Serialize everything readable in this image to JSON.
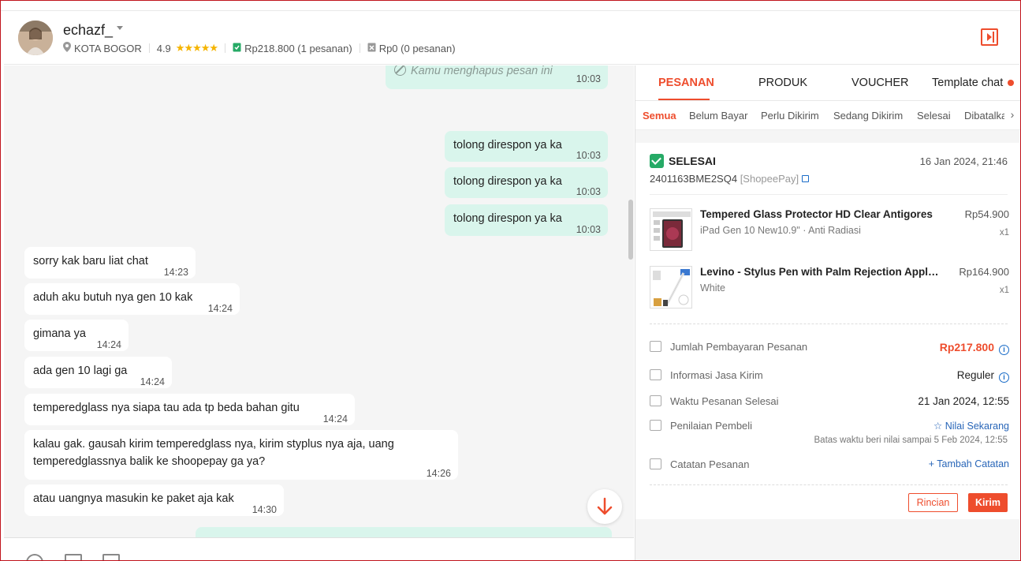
{
  "header": {
    "username": "echazf_",
    "location": "KOTA BOGOR",
    "rating": "4.9",
    "stars": "★★★★★",
    "total_spent": "Rp218.800 (1 pesanan)",
    "refund": "Rp0 (0 pesanan)"
  },
  "chat": {
    "messages": [
      {
        "dir": "out",
        "text": "Kamu menghapus pesan ini",
        "time": "10:03",
        "deleted": true
      },
      {
        "dir": "out",
        "text": "tolong direspon ya ka",
        "time": "10:03"
      },
      {
        "dir": "out",
        "text": "tolong direspon ya ka",
        "time": "10:03"
      },
      {
        "dir": "out",
        "text": "tolong direspon ya ka",
        "time": "10:03"
      },
      {
        "dir": "in",
        "text": "sorry kak baru liat chat",
        "time": "14:23"
      },
      {
        "dir": "in",
        "text": "aduh aku butuh nya gen 10 kak",
        "time": "14:24"
      },
      {
        "dir": "in",
        "text": "gimana ya",
        "time": "14:24"
      },
      {
        "dir": "in",
        "text": "ada gen 10 lagi ga",
        "time": "14:24"
      },
      {
        "dir": "in",
        "text": "temperedglass nya siapa tau ada tp beda bahan gitu",
        "time": "14:24"
      },
      {
        "dir": "in",
        "text_line1": "kalau gak. gausah kirim temperedglass nya, kirim styplus nya aja, uang",
        "text_line2": "temperedglassnya balik ke shoopepay ga ya?",
        "time": "14:26"
      },
      {
        "dir": "in",
        "text": "atau uangnya masukin ke paket aja kak",
        "time": "14:30"
      }
    ]
  },
  "panel": {
    "tabs": [
      "PESANAN",
      "PRODUK",
      "VOUCHER",
      "Template chat"
    ],
    "subtabs": [
      "Semua",
      "Belum Bayar",
      "Perlu Dikirim",
      "Sedang Dikirim",
      "Selesai",
      "Dibatalkan"
    ],
    "order": {
      "status": "SELESAI",
      "date": "16 Jan 2024, 21:46",
      "order_id": "2401163BME2SQ4",
      "payment": "[ShopeePay]",
      "products": [
        {
          "name": "Tempered Glass Protector HD Clear Antigores",
          "variant": "iPad Gen 10 New10.9\" · Anti Radiasi",
          "price": "Rp54.900",
          "qty": "x1"
        },
        {
          "name": "Levino - Stylus Pen with Palm Rejection Apple Pencil",
          "variant": "White",
          "price": "Rp164.900",
          "qty": "x1"
        }
      ],
      "payment_label": "Jumlah Pembayaran Pesanan",
      "payment_value": "Rp217.800",
      "shipping_label": "Informasi Jasa Kirim",
      "shipping_value": "Reguler",
      "completed_label": "Waktu Pesanan Selesai",
      "completed_value": "21 Jan 2024, 12:55",
      "review_label": "Penilaian Pembeli",
      "review_value": "Nilai Sekarang",
      "review_deadline": "Batas waktu beri nilai sampai 5 Feb 2024, 12:55",
      "note_label": "Catatan Pesanan",
      "note_value": "Tambah Catatan",
      "btn_details": "Rincian",
      "btn_send": "Kirim"
    }
  }
}
